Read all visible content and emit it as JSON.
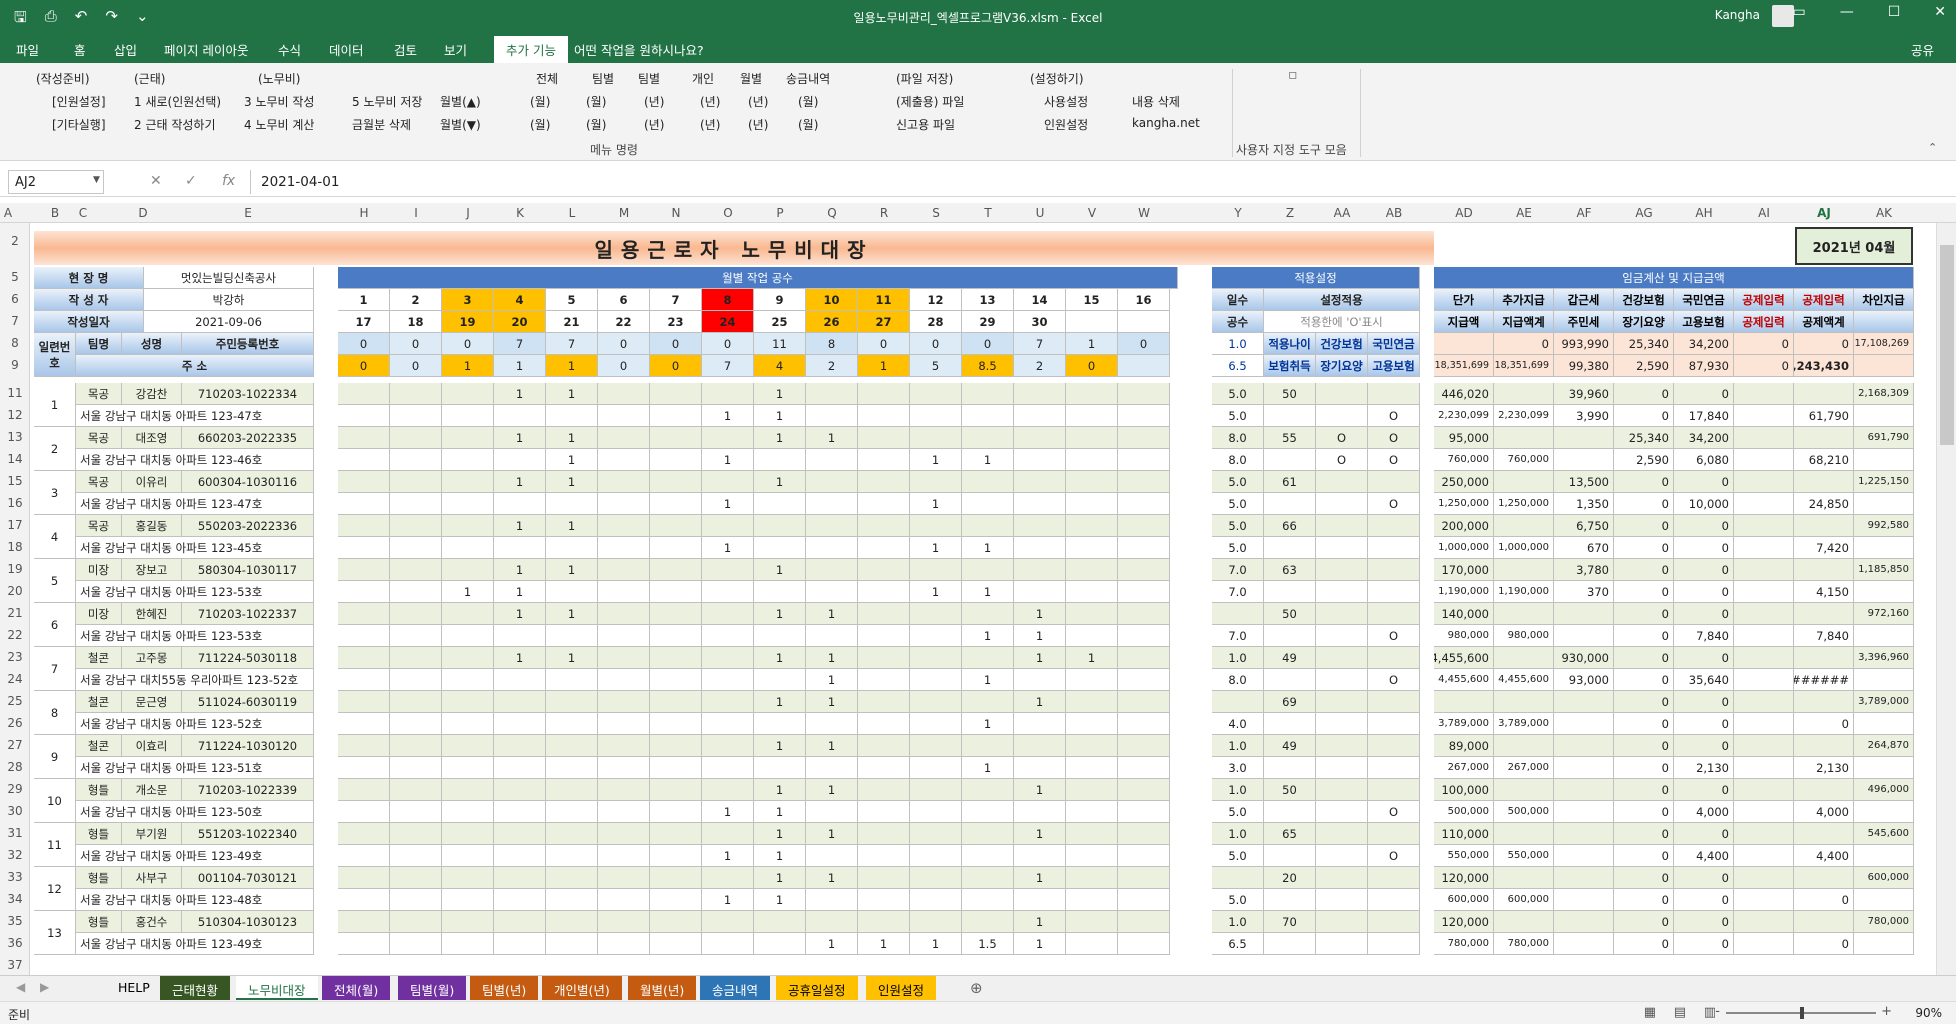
{
  "window": {
    "title": "일용노무비관리_엑셀프로그램V36.xlsm  -  Excel",
    "user": "Kangha"
  },
  "tabs": [
    "파일",
    "홈",
    "삽입",
    "페이지 레이아웃",
    "수식",
    "데이터",
    "검토",
    "보기",
    "추가 기능",
    "어떤 작업을 원하시나요?"
  ],
  "active_tab": "추가 기능",
  "share": "공유",
  "ribbon": {
    "r1": [
      "(작성준비)",
      "(근태)",
      "(노무비)",
      "전체",
      "팀별",
      "팀별",
      "개인",
      "월별",
      "송금내역",
      "(파일 저장)",
      "(설정하기)"
    ],
    "r2": [
      "[인원설정]",
      "1 새로(인원선택)",
      "3 노무비 작성",
      "5 노무비 저장",
      "월별(▲)",
      "(월)",
      "(월)",
      "(년)",
      "(년)",
      "(년)",
      "(월)",
      "(제출용) 파일",
      "사용설정",
      "내용 삭제"
    ],
    "r3": [
      "[기타실행]",
      "2 근태 작성하기",
      "4 노무비 계산",
      "금월분 삭제",
      "월별(▼)",
      "(월)",
      "(월)",
      "(년)",
      "(년)",
      "(년)",
      "(월)",
      "신고용 파일",
      "인원설정",
      "kangha.net"
    ],
    "group1": "메뉴 명령",
    "group2": "사용자 지정 도구 모음"
  },
  "namebox": "AJ2",
  "formula": "2021-04-01",
  "columns": [
    "A",
    "B",
    "C",
    "D",
    "E",
    "H",
    "I",
    "J",
    "K",
    "L",
    "M",
    "N",
    "O",
    "P",
    "Q",
    "R",
    "S",
    "T",
    "U",
    "V",
    "W",
    "Y",
    "Z",
    "AA",
    "AB",
    "AD",
    "AE",
    "AF",
    "AG",
    "AH",
    "AI",
    "AJ",
    "AK"
  ],
  "rows": [
    "2",
    "5",
    "6",
    "7",
    "8",
    "9",
    "11",
    "12",
    "13",
    "14",
    "15",
    "16",
    "17",
    "18",
    "19",
    "20",
    "21",
    "22",
    "23",
    "24",
    "25",
    "26",
    "27",
    "28",
    "29",
    "30",
    "31",
    "32",
    "33",
    "34",
    "35",
    "36",
    "37"
  ],
  "sheet": {
    "title": "일용근로자 노무비대장",
    "month": "2021년 04월",
    "site_label": "현 장 명",
    "site": "멋있는빌딩신축공사",
    "writer_label": "작 성 자",
    "writer": "박강하",
    "date_label": "작성일자",
    "date": "2021-09-06",
    "workdays_header": "월별 작업 공수",
    "settings_header": "적용설정",
    "pay_header": "임금계산 및 지급금액",
    "seq_label": "일련번호",
    "team_label": "팀명",
    "name_label": "성명",
    "id_label": "주민등록번호",
    "addr_label": "주 소",
    "days1": [
      "1",
      "2",
      "3",
      "4",
      "5",
      "6",
      "7",
      "8",
      "9",
      "10",
      "11",
      "12",
      "13",
      "14",
      "15",
      "16"
    ],
    "days2": [
      "17",
      "18",
      "19",
      "20",
      "21",
      "22",
      "23",
      "24",
      "25",
      "26",
      "27",
      "28",
      "29",
      "30",
      "",
      ""
    ],
    "cnt1": [
      "0",
      "0",
      "0",
      "7",
      "7",
      "0",
      "0",
      "0",
      "11",
      "8",
      "0",
      "0",
      "0",
      "7",
      "1",
      "0"
    ],
    "cnt2": [
      "0",
      "0",
      "1",
      "1",
      "1",
      "0",
      "0",
      "7",
      "4",
      "2",
      "1",
      "5",
      "8.5",
      "2",
      "0",
      ""
    ],
    "set_labels": [
      "일수",
      "설정적용",
      "공수",
      "적용한에 'O'표시",
      "1.0",
      "적용나이",
      "건강보험",
      "국민연금",
      "6.5",
      "보험취득",
      "장기요양",
      "고용보험"
    ],
    "pay_labels": [
      "단가",
      "추가지급",
      "갑근세",
      "건강보험",
      "국민연금",
      "공제입력",
      "공제입력",
      "차인지급",
      "지급액",
      "지급액계",
      "주민세",
      "장기요양",
      "고용보험",
      "공제입력",
      "공제액계"
    ],
    "pay_tot1": [
      "",
      "0",
      "993,990",
      "25,340",
      "34,200",
      "0",
      "0",
      "17,108,269"
    ],
    "pay_tot2": [
      "18,351,699",
      "18,351,699",
      "99,380",
      "2,590",
      "87,930",
      "0",
      "1,243,430",
      ""
    ]
  },
  "workers": [
    {
      "seq": "1",
      "team": "목공",
      "name": "강감찬",
      "id": "710203-1022334",
      "addr": "서울 강남구 대치동 아파트 123-47호",
      "d1": [
        "",
        "",
        "",
        "1",
        "1",
        "",
        "",
        "",
        "1",
        "",
        "",
        "",
        "",
        "",
        "",
        ""
      ],
      "d2": [
        "",
        "",
        "",
        "",
        "",
        "",
        "",
        "1",
        "1",
        "",
        "",
        "",
        "",
        "",
        "",
        ""
      ],
      "s1": [
        "5.0",
        "50",
        "",
        ""
      ],
      "s2": [
        "5.0",
        "",
        "",
        "O"
      ],
      "p1": [
        "446,020",
        "",
        "39,960",
        "0",
        "0",
        "",
        "",
        "2,168,309"
      ],
      "p2": [
        "2,230,099",
        "2,230,099",
        "3,990",
        "0",
        "17,840",
        "",
        "61,790",
        ""
      ]
    },
    {
      "seq": "2",
      "team": "목공",
      "name": "대조영",
      "id": "660203-2022335",
      "addr": "서울 강남구 대치동 아파트 123-46호",
      "d1": [
        "",
        "",
        "",
        "1",
        "1",
        "",
        "",
        "",
        "1",
        "1",
        "",
        "",
        "",
        "",
        "",
        ""
      ],
      "d2": [
        "",
        "",
        "",
        "",
        "1",
        "",
        "",
        "1",
        "",
        "",
        "",
        "1",
        "1",
        "",
        "",
        ""
      ],
      "s1": [
        "8.0",
        "55",
        "O",
        "O"
      ],
      "s2": [
        "8.0",
        "",
        "O",
        "O"
      ],
      "p1": [
        "95,000",
        "",
        "",
        "25,340",
        "34,200",
        "",
        "",
        "691,790"
      ],
      "p2": [
        "760,000",
        "760,000",
        "",
        "2,590",
        "6,080",
        "",
        "68,210",
        ""
      ]
    },
    {
      "seq": "3",
      "team": "목공",
      "name": "이유리",
      "id": "600304-1030116",
      "addr": "서울 강남구 대치동 아파트 123-47호",
      "d1": [
        "",
        "",
        "",
        "1",
        "1",
        "",
        "",
        "",
        "1",
        "",
        "",
        "",
        "",
        "",
        "",
        ""
      ],
      "d2": [
        "",
        "",
        "",
        "",
        "",
        "",
        "",
        "1",
        "",
        "",
        "",
        "1",
        "",
        "",
        "",
        ""
      ],
      "s1": [
        "5.0",
        "61",
        "",
        ""
      ],
      "s2": [
        "5.0",
        "",
        "",
        "O"
      ],
      "p1": [
        "250,000",
        "",
        "13,500",
        "0",
        "0",
        "",
        "",
        "1,225,150"
      ],
      "p2": [
        "1,250,000",
        "1,250,000",
        "1,350",
        "0",
        "10,000",
        "",
        "24,850",
        ""
      ]
    },
    {
      "seq": "4",
      "team": "목공",
      "name": "홍길동",
      "id": "550203-2022336",
      "addr": "서울 강남구 대치동 아파트 123-45호",
      "d1": [
        "",
        "",
        "",
        "1",
        "1",
        "",
        "",
        "",
        "",
        "",
        "",
        "",
        "",
        "",
        "",
        ""
      ],
      "d2": [
        "",
        "",
        "",
        "",
        "",
        "",
        "",
        "1",
        "",
        "",
        "",
        "1",
        "1",
        "",
        "",
        ""
      ],
      "s1": [
        "5.0",
        "66",
        "",
        ""
      ],
      "s2": [
        "5.0",
        "",
        "",
        ""
      ],
      "p1": [
        "200,000",
        "",
        "6,750",
        "0",
        "0",
        "",
        "",
        "992,580"
      ],
      "p2": [
        "1,000,000",
        "1,000,000",
        "670",
        "0",
        "0",
        "",
        "7,420",
        ""
      ]
    },
    {
      "seq": "5",
      "team": "미장",
      "name": "장보고",
      "id": "580304-1030117",
      "addr": "서울 강남구 대치동 아파트 123-53호",
      "d1": [
        "",
        "",
        "",
        "1",
        "1",
        "",
        "",
        "",
        "1",
        "",
        "",
        "",
        "",
        "",
        "",
        ""
      ],
      "d2": [
        "",
        "",
        "1",
        "1",
        "",
        "",
        "",
        "",
        "",
        "",
        "",
        "1",
        "1",
        "",
        "",
        ""
      ],
      "s1": [
        "7.0",
        "63",
        "",
        ""
      ],
      "s2": [
        "7.0",
        "",
        "",
        ""
      ],
      "p1": [
        "170,000",
        "",
        "3,780",
        "0",
        "0",
        "",
        "",
        "1,185,850"
      ],
      "p2": [
        "1,190,000",
        "1,190,000",
        "370",
        "0",
        "0",
        "",
        "4,150",
        ""
      ]
    },
    {
      "seq": "6",
      "team": "미장",
      "name": "한혜진",
      "id": "710203-1022337",
      "addr": "서울 강남구 대치동 아파트 123-53호",
      "d1": [
        "",
        "",
        "",
        "1",
        "1",
        "",
        "",
        "",
        "1",
        "1",
        "",
        "",
        "",
        "1",
        "",
        ""
      ],
      "d2": [
        "",
        "",
        "",
        "",
        "",
        "",
        "",
        "",
        "",
        "",
        "",
        "",
        "1",
        "1",
        "",
        ""
      ],
      "s1": [
        "",
        "50",
        "",
        ""
      ],
      "s2": [
        "7.0",
        "",
        "",
        "O"
      ],
      "p1": [
        "140,000",
        "",
        "",
        "0",
        "0",
        "",
        "",
        "972,160"
      ],
      "p2": [
        "980,000",
        "980,000",
        "",
        "0",
        "7,840",
        "",
        "7,840",
        ""
      ]
    },
    {
      "seq": "7",
      "team": "철콘",
      "name": "고주몽",
      "id": "711224-5030118",
      "addr": "서울 강남구 대치55동 우리아파트 123-52호",
      "d1": [
        "",
        "",
        "",
        "1",
        "1",
        "",
        "",
        "",
        "1",
        "1",
        "",
        "",
        "",
        "1",
        "1",
        ""
      ],
      "d2": [
        "",
        "",
        "",
        "",
        "",
        "",
        "",
        "",
        "",
        "1",
        "",
        "",
        "1",
        "",
        "",
        ""
      ],
      "s1": [
        "1.0",
        "49",
        "",
        ""
      ],
      "s2": [
        "8.0",
        "",
        "",
        "O"
      ],
      "p1": [
        "4,455,600",
        "",
        "930,000",
        "0",
        "0",
        "",
        "",
        "3,396,960"
      ],
      "p2": [
        "4,455,600",
        "4,455,600",
        "93,000",
        "0",
        "35,640",
        "",
        "#######",
        ""
      ]
    },
    {
      "seq": "8",
      "team": "철콘",
      "name": "문근영",
      "id": "511024-6030119",
      "addr": "서울 강남구 대치동 아파트 123-52호",
      "d1": [
        "",
        "",
        "",
        "",
        "",
        "",
        "",
        "",
        "1",
        "1",
        "",
        "",
        "",
        "1",
        "",
        ""
      ],
      "d2": [
        "",
        "",
        "",
        "",
        "",
        "",
        "",
        "",
        "",
        "",
        "",
        "",
        "1",
        "",
        "",
        ""
      ],
      "s1": [
        "",
        "69",
        "",
        ""
      ],
      "s2": [
        "4.0",
        "",
        "",
        ""
      ],
      "p1": [
        "",
        "",
        "",
        "0",
        "0",
        "",
        "",
        "3,789,000"
      ],
      "p2": [
        "3,789,000",
        "3,789,000",
        "",
        "0",
        "0",
        "",
        "0",
        ""
      ]
    },
    {
      "seq": "9",
      "team": "철콘",
      "name": "이효리",
      "id": "711224-1030120",
      "addr": "서울 강남구 대치동 아파트 123-51호",
      "d1": [
        "",
        "",
        "",
        "",
        "",
        "",
        "",
        "",
        "1",
        "1",
        "",
        "",
        "",
        "",
        "",
        ""
      ],
      "d2": [
        "",
        "",
        "",
        "",
        "",
        "",
        "",
        "",
        "",
        "",
        "",
        "",
        "1",
        "",
        "",
        ""
      ],
      "s1": [
        "1.0",
        "49",
        "",
        ""
      ],
      "s2": [
        "3.0",
        "",
        "",
        ""
      ],
      "p1": [
        "89,000",
        "",
        "",
        "0",
        "0",
        "",
        "",
        "264,870"
      ],
      "p2": [
        "267,000",
        "267,000",
        "",
        "0",
        "2,130",
        "",
        "2,130",
        ""
      ]
    },
    {
      "seq": "10",
      "team": "형틀",
      "name": "개소문",
      "id": "710203-1022339",
      "addr": "서울 강남구 대치동 아파트 123-50호",
      "d1": [
        "",
        "",
        "",
        "",
        "",
        "",
        "",
        "",
        "1",
        "1",
        "",
        "",
        "",
        "1",
        "",
        ""
      ],
      "d2": [
        "",
        "",
        "",
        "",
        "",
        "",
        "",
        "1",
        "1",
        "",
        "",
        "",
        "",
        "",
        "",
        ""
      ],
      "s1": [
        "1.0",
        "50",
        "",
        ""
      ],
      "s2": [
        "5.0",
        "",
        "",
        "O"
      ],
      "p1": [
        "100,000",
        "",
        "",
        "0",
        "0",
        "",
        "",
        "496,000"
      ],
      "p2": [
        "500,000",
        "500,000",
        "",
        "0",
        "4,000",
        "",
        "4,000",
        ""
      ]
    },
    {
      "seq": "11",
      "team": "형틀",
      "name": "부기원",
      "id": "551203-1022340",
      "addr": "서울 강남구 대치동 아파트 123-49호",
      "d1": [
        "",
        "",
        "",
        "",
        "",
        "",
        "",
        "",
        "1",
        "1",
        "",
        "",
        "",
        "1",
        "",
        ""
      ],
      "d2": [
        "",
        "",
        "",
        "",
        "",
        "",
        "",
        "1",
        "1",
        "",
        "",
        "",
        "",
        "",
        "",
        ""
      ],
      "s1": [
        "1.0",
        "65",
        "",
        ""
      ],
      "s2": [
        "5.0",
        "",
        "",
        "O"
      ],
      "p1": [
        "110,000",
        "",
        "",
        "0",
        "0",
        "",
        "",
        "545,600"
      ],
      "p2": [
        "550,000",
        "550,000",
        "",
        "0",
        "4,400",
        "",
        "4,400",
        ""
      ]
    },
    {
      "seq": "12",
      "team": "형틀",
      "name": "사부구",
      "id": "001104-7030121",
      "addr": "서울 강남구 대치동 아파트 123-48호",
      "d1": [
        "",
        "",
        "",
        "",
        "",
        "",
        "",
        "",
        "1",
        "1",
        "",
        "",
        "",
        "1",
        "",
        ""
      ],
      "d2": [
        "",
        "",
        "",
        "",
        "",
        "",
        "",
        "1",
        "1",
        "",
        "",
        "",
        "",
        "",
        "",
        ""
      ],
      "s1": [
        "",
        "20",
        "",
        ""
      ],
      "s2": [
        "5.0",
        "",
        "",
        ""
      ],
      "p1": [
        "120,000",
        "",
        "",
        "0",
        "0",
        "",
        "",
        "600,000"
      ],
      "p2": [
        "600,000",
        "600,000",
        "",
        "0",
        "0",
        "",
        "0",
        ""
      ]
    },
    {
      "seq": "13",
      "team": "형틀",
      "name": "홍건수",
      "id": "510304-1030123",
      "addr": "서울 강남구 대치동 아파트 123-49호",
      "d1": [
        "",
        "",
        "",
        "",
        "",
        "",
        "",
        "",
        "",
        "",
        "",
        "",
        "",
        "1",
        "",
        ""
      ],
      "d2": [
        "",
        "",
        "",
        "",
        "",
        "",
        "",
        "",
        "",
        "1",
        "1",
        "1",
        "1.5",
        "1",
        "",
        ""
      ],
      "s1": [
        "1.0",
        "70",
        "",
        ""
      ],
      "s2": [
        "6.5",
        "",
        "",
        ""
      ],
      "p1": [
        "120,000",
        "",
        "",
        "0",
        "0",
        "",
        "",
        "780,000"
      ],
      "p2": [
        "780,000",
        "780,000",
        "",
        "0",
        "0",
        "",
        "0",
        ""
      ]
    }
  ],
  "sheet_tabs": [
    "HELP",
    "근태현황",
    "노무비대장",
    "전체(월)",
    "팀별(월)",
    "팀별(년)",
    "개인별(년)",
    "월별(년)",
    "송금내역",
    "공휴일설정",
    "인원설정"
  ],
  "active_sheet": "노무비대장",
  "tab_colors": [
    "#f0f0f0",
    "#375623",
    "#ffffff",
    "#7030a0",
    "#7030a0",
    "#c55a11",
    "#c55a11",
    "#c55a11",
    "#2e75b6",
    "#ffc000",
    "#ffc000"
  ],
  "status": {
    "ready": "준비",
    "zoom": "90%"
  }
}
